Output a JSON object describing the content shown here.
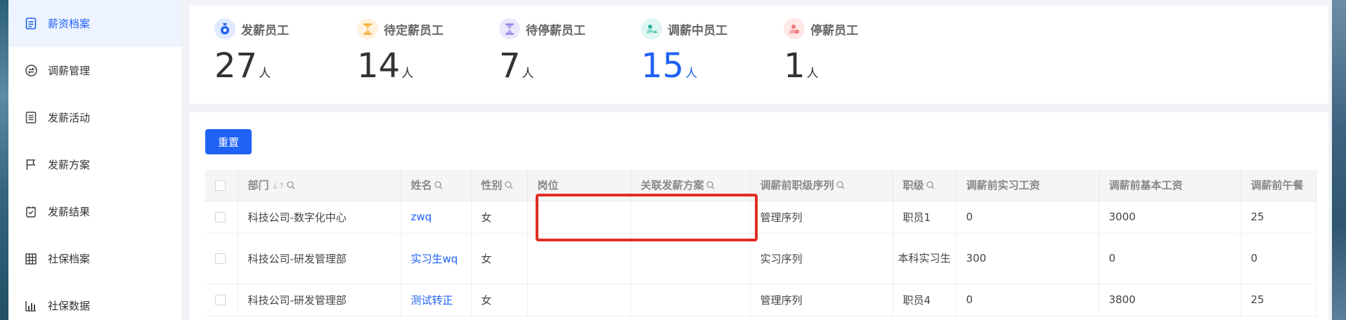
{
  "sidebar": {
    "items": [
      {
        "label": "薪资档案",
        "icon": "document-icon",
        "active": true
      },
      {
        "label": "调薪管理",
        "icon": "exchange-icon",
        "active": false
      },
      {
        "label": "发薪活动",
        "icon": "list-icon",
        "active": false
      },
      {
        "label": "发薪方案",
        "icon": "flag-icon",
        "active": false
      },
      {
        "label": "发薪结果",
        "icon": "check-shield-icon",
        "active": false
      },
      {
        "label": "社保档案",
        "icon": "grid-icon",
        "active": false
      },
      {
        "label": "社保数据",
        "icon": "bar-chart-icon",
        "active": false
      }
    ]
  },
  "stats": [
    {
      "label": "发薪员工",
      "value": "27",
      "unit": "人",
      "icon": "money-bag-icon",
      "color": "#1f62f5"
    },
    {
      "label": "待定薪员工",
      "value": "14",
      "unit": "人",
      "icon": "hourglass-icon",
      "color": "#f5a623"
    },
    {
      "label": "待停薪员工",
      "value": "7",
      "unit": "人",
      "icon": "hourglass-icon",
      "color": "#8c7ae6"
    },
    {
      "label": "调薪中员工",
      "value": "15",
      "unit": "人",
      "icon": "transfer-icon",
      "color": "#2bb5a2"
    },
    {
      "label": "停薪员工",
      "value": "1",
      "unit": "人",
      "icon": "stop-person-icon",
      "color": "#f07a7a"
    }
  ],
  "toolbar": {
    "reset_label": "重置"
  },
  "table": {
    "columns": [
      "部门",
      "姓名",
      "性别",
      "岗位",
      "关联发薪方案",
      "调薪前职级序列",
      "职级",
      "调薪前实习工资",
      "调薪前基本工资",
      "调薪前午餐"
    ],
    "rows": [
      [
        "科技公司-数字化中心",
        "zwq",
        "女",
        "",
        "",
        "管理序列",
        "职员1",
        "0",
        "3000",
        "25"
      ],
      [
        "科技公司-研发管理部",
        "实习生wq",
        "女",
        "",
        "",
        "实习序列",
        "本科实习生",
        "300",
        "0",
        "0"
      ],
      [
        "科技公司-研发管理部",
        "测试转正",
        "女",
        "",
        "",
        "管理序列",
        "职员4",
        "0",
        "3800",
        "25"
      ]
    ]
  },
  "colors": {
    "accent": "#1f62f5",
    "highlight": "#e02e24"
  }
}
